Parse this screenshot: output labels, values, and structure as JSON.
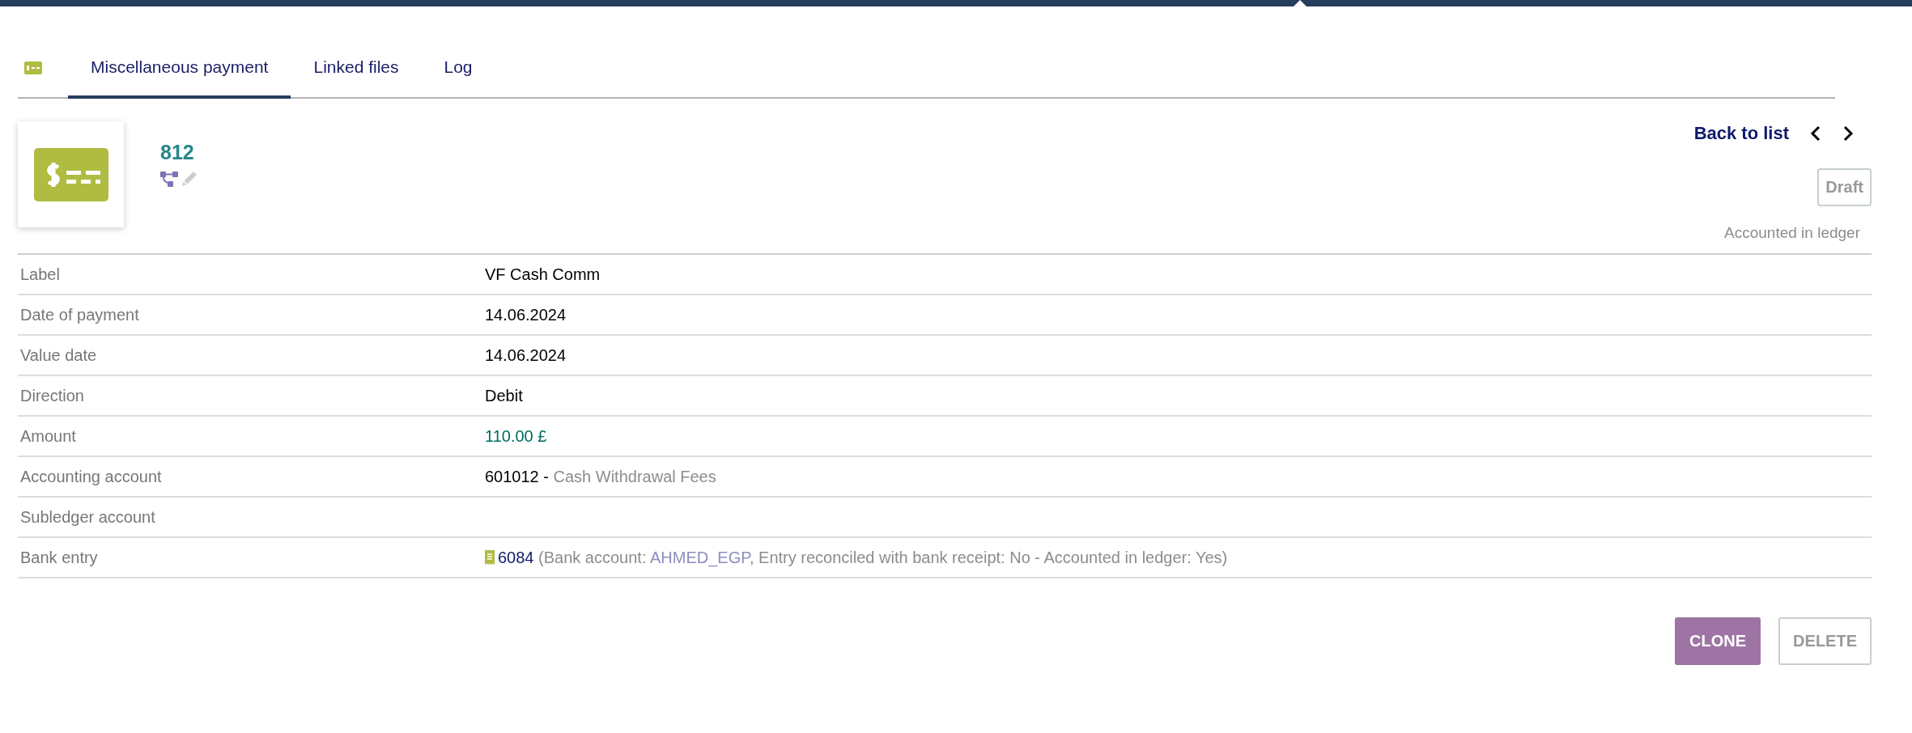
{
  "tabs": [
    {
      "label": "Miscellaneous payment",
      "selected": true
    },
    {
      "label": "Linked files",
      "selected": false
    },
    {
      "label": "Log",
      "selected": false
    }
  ],
  "record": {
    "ref": "812",
    "back_link": "Back to list",
    "status": "Draft",
    "status_note": "Accounted in ledger"
  },
  "fields": [
    {
      "kind": "text",
      "label": "Label",
      "value": "VF Cash Comm"
    },
    {
      "kind": "text",
      "label": "Date of payment",
      "value": "14.06.2024"
    },
    {
      "kind": "text",
      "label": "Value date",
      "value": "14.06.2024"
    },
    {
      "kind": "text",
      "label": "Direction",
      "value": "Debit"
    },
    {
      "kind": "amount",
      "label": "Amount",
      "value": "110.00 £"
    },
    {
      "kind": "account",
      "label": "Accounting account",
      "code": "601012 -",
      "name": "Cash Withdrawal Fees"
    },
    {
      "kind": "text",
      "label": "Subledger account"
    },
    {
      "kind": "bank",
      "label": "Bank entry",
      "ref": "6084",
      "prefix": "(Bank account:",
      "account": "AHMED_EGP",
      "suffix": ", Entry reconciled with bank receipt: No - Accounted in ledger: Yes)"
    }
  ],
  "buttons": [
    {
      "label": "CLONE",
      "disabled": false
    },
    {
      "label": "DELETE",
      "disabled": true
    }
  ]
}
